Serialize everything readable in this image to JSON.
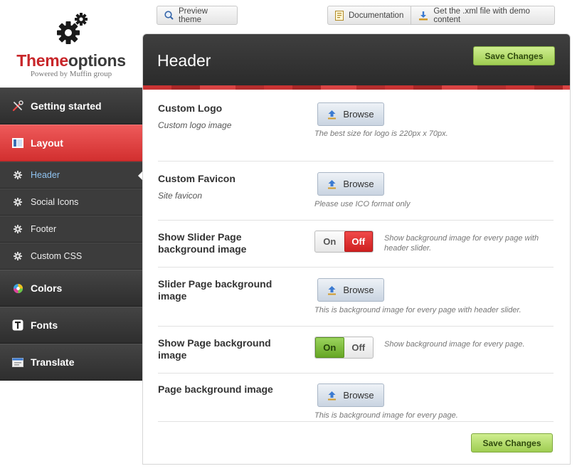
{
  "brand": {
    "name_part1": "Theme",
    "name_part2": "options",
    "tagline": "Powered by Muffin group"
  },
  "toolbar": {
    "preview_label": "Preview theme",
    "documentation_label": "Documentation",
    "demo_label": "Get the .xml file with demo content"
  },
  "sidebar": {
    "items": [
      {
        "label": "Getting started",
        "icon": "tools-icon"
      },
      {
        "label": "Layout",
        "icon": "layout-icon",
        "active": true
      },
      {
        "label": "Header",
        "icon": "gear-icon",
        "current": true
      },
      {
        "label": "Social Icons",
        "icon": "gear-icon"
      },
      {
        "label": "Footer",
        "icon": "gear-icon"
      },
      {
        "label": "Custom CSS",
        "icon": "gear-icon"
      },
      {
        "label": "Colors",
        "icon": "color-wheel-icon"
      },
      {
        "label": "Fonts",
        "icon": "font-icon"
      },
      {
        "label": "Translate",
        "icon": "translate-icon"
      }
    ]
  },
  "panel": {
    "title": "Header",
    "save_label": "Save Changes"
  },
  "fields": [
    {
      "label": "Custom Logo",
      "sub": "Custom logo image",
      "control": "Browse",
      "hint": "The best size for logo is 220px x 70px."
    },
    {
      "label": "Custom Favicon",
      "sub": "Site favicon",
      "control": "Browse",
      "hint": "Please use ICO format only"
    },
    {
      "label": "Show Slider Page background image",
      "on": "On",
      "off": "Off",
      "state": "off",
      "hint": "Show background image for every page with header slider."
    },
    {
      "label": "Slider Page background image",
      "control": "Browse",
      "hint": "This is background image for every page with header slider."
    },
    {
      "label": "Show Page background image",
      "on": "On",
      "off": "Off",
      "state": "on",
      "hint": "Show background image for every page."
    },
    {
      "label": "Page background image",
      "control": "Browse",
      "hint": "This is background image for every page."
    }
  ],
  "colors": {
    "accent_red": "#d22f2f",
    "save_green": "#9fcd52",
    "sidebar_dark": "#3c3c3c",
    "current_link": "#8fc3f0"
  }
}
